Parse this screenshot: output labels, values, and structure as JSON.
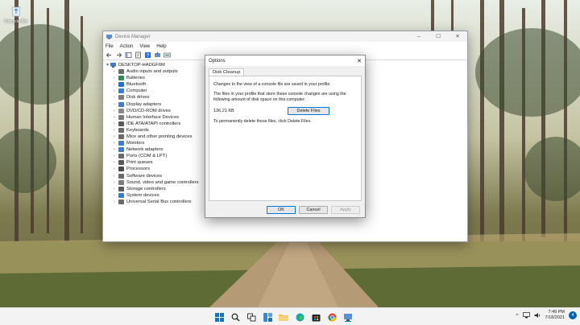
{
  "desktop": {
    "recycle_bin_label": "Recycle Bin"
  },
  "device_manager": {
    "title": "Device Manager",
    "controls": [
      "–",
      "☐",
      "✕"
    ],
    "menu": [
      "File",
      "Action",
      "View",
      "Help"
    ],
    "tree_root": "DESKTOP-HADGF6M",
    "tree_items": [
      {
        "label": "Audio inputs and outputs",
        "color": "#6b6b6b"
      },
      {
        "label": "Batteries",
        "color": "#2e8b57"
      },
      {
        "label": "Bluetooth",
        "color": "#1e6fd9"
      },
      {
        "label": "Computer",
        "color": "#3a7bd5"
      },
      {
        "label": "Disk drives",
        "color": "#7d7d7d"
      },
      {
        "label": "Display adapters",
        "color": "#3a7bd5"
      },
      {
        "label": "DVD/CD-ROM drives",
        "color": "#8a8a8a"
      },
      {
        "label": "Human Interface Devices",
        "color": "#7d7d7d"
      },
      {
        "label": "IDE ATA/ATAPI controllers",
        "color": "#5a5a5a"
      },
      {
        "label": "Keyboards",
        "color": "#6b6b6b"
      },
      {
        "label": "Mice and other pointing devices",
        "color": "#6b6b6b"
      },
      {
        "label": "Monitors",
        "color": "#3a7bd5"
      },
      {
        "label": "Network adapters",
        "color": "#3a7bd5"
      },
      {
        "label": "Ports (COM & LPT)",
        "color": "#6b6b6b"
      },
      {
        "label": "Print queues",
        "color": "#5a5a5a"
      },
      {
        "label": "Processors",
        "color": "#4a4a4a"
      },
      {
        "label": "Software devices",
        "color": "#6b6b6b"
      },
      {
        "label": "Sound, video and game controllers",
        "color": "#7d7d7d"
      },
      {
        "label": "Storage controllers",
        "color": "#5a5a5a"
      },
      {
        "label": "System devices",
        "color": "#3a7bd5"
      },
      {
        "label": "Universal Serial Bus controllers",
        "color": "#6b6b6b"
      }
    ]
  },
  "options_dialog": {
    "title": "Options",
    "close": "✕",
    "tab": "Disk Cleanup",
    "intro": "Changes to the view of a console file are saved in your profile.",
    "files_text": "The files in your profile that store these console changes are using the following amount of disk space on this computer:",
    "size": "136.21 KB",
    "delete_button": "Delete Files",
    "hint": "To permanently delete these files, click Delete Files.",
    "ok": "OK",
    "cancel": "Cancel",
    "apply": "Apply"
  },
  "taskbar": {
    "time": "7:49 PM",
    "date": "7/18/2021",
    "notification_count": "4",
    "tray_chevron": "^"
  }
}
